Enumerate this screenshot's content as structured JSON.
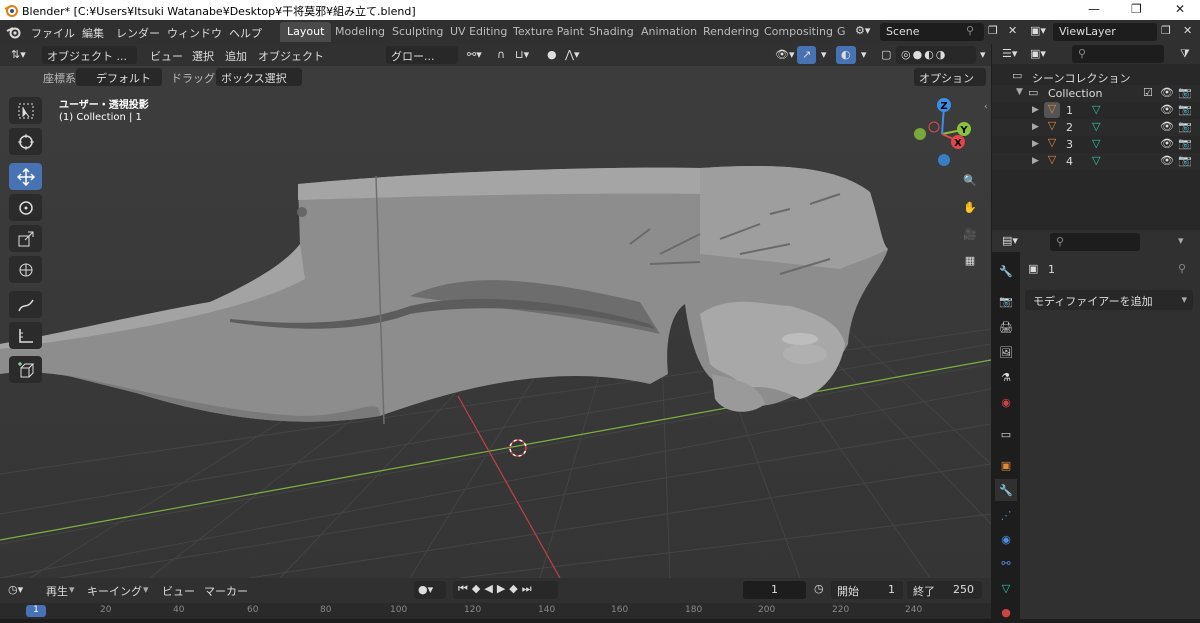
{
  "window": {
    "title": "Blender* [C:¥Users¥Itsuki Watanabe¥Desktop¥干将莫邪¥組み立て.blend]",
    "minimize": "—",
    "maximize": "❐",
    "close": "✕"
  },
  "menubar": {
    "items": [
      "ファイル",
      "編集",
      "レンダー",
      "ウィンドウ",
      "ヘルプ"
    ]
  },
  "workspaces": {
    "tabs": [
      "Layout",
      "Modeling",
      "Sculpting",
      "UV Editing",
      "Texture Paint",
      "Shading",
      "Animation",
      "Rendering",
      "Compositing",
      "G"
    ],
    "active": "Layout"
  },
  "scene": {
    "name": "Scene"
  },
  "view_layer": {
    "name": "ViewLayer"
  },
  "viewport": {
    "mode": "オブジェクト ...",
    "menus": [
      "ビュー",
      "選択",
      "追加",
      "オブジェクト"
    ],
    "transform_orientation": "グロー...",
    "coord_label": "座標系:",
    "coord_value": "デフォルト",
    "drag_label": "ドラッグ:",
    "drag_value": "ボックス選択",
    "options": "オプション",
    "overlay_title": "ユーザー・透視投影",
    "overlay_subtitle": "(1) Collection | 1",
    "gizmo": {
      "x": "X",
      "y": "Y",
      "z": "Z"
    }
  },
  "colors": {
    "accent": "#4772b3",
    "x_axis": "#e2454c",
    "y_axis": "#8ac33a",
    "z_axis": "#3a8ee6",
    "mesh_orange": "#e08a3c",
    "modifier_teal": "#2fc7a6"
  },
  "toolbar": {
    "tools": [
      "select-box-icon",
      "cursor-icon",
      "move-icon",
      "rotate-icon",
      "scale-icon",
      "transform-icon",
      "annotate-icon",
      "measure-icon",
      "add-cube-icon"
    ]
  },
  "outliner": {
    "root": "シーンコレクション",
    "collection": "Collection",
    "objects": [
      "1",
      "2",
      "3",
      "4"
    ]
  },
  "properties": {
    "object_name": "1",
    "add_modifier": "モディファイアーを追加"
  },
  "timeline": {
    "playback": "再生",
    "keying": "キーイング",
    "view": "ビュー",
    "marker": "マーカー",
    "current_frame": "1",
    "start_label": "開始",
    "start": "1",
    "end_label": "終了",
    "end": "250",
    "ruler": [
      "1",
      "20",
      "40",
      "60",
      "80",
      "100",
      "120",
      "140",
      "160",
      "180",
      "200",
      "220",
      "240"
    ]
  }
}
